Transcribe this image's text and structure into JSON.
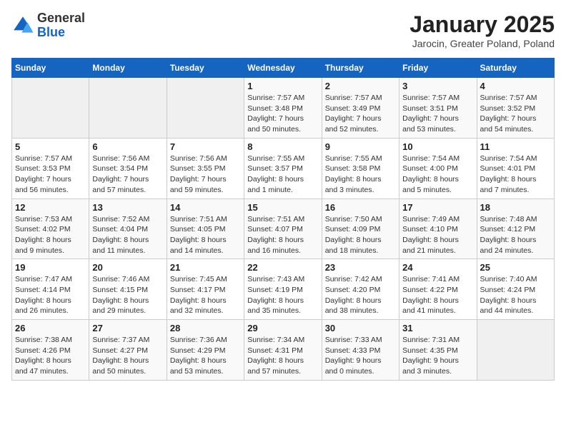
{
  "header": {
    "logo_general": "General",
    "logo_blue": "Blue",
    "month_title": "January 2025",
    "subtitle": "Jarocin, Greater Poland, Poland"
  },
  "days_of_week": [
    "Sunday",
    "Monday",
    "Tuesday",
    "Wednesday",
    "Thursday",
    "Friday",
    "Saturday"
  ],
  "weeks": [
    [
      {
        "day": "",
        "info": ""
      },
      {
        "day": "",
        "info": ""
      },
      {
        "day": "",
        "info": ""
      },
      {
        "day": "1",
        "info": "Sunrise: 7:57 AM\nSunset: 3:48 PM\nDaylight: 7 hours\nand 50 minutes."
      },
      {
        "day": "2",
        "info": "Sunrise: 7:57 AM\nSunset: 3:49 PM\nDaylight: 7 hours\nand 52 minutes."
      },
      {
        "day": "3",
        "info": "Sunrise: 7:57 AM\nSunset: 3:51 PM\nDaylight: 7 hours\nand 53 minutes."
      },
      {
        "day": "4",
        "info": "Sunrise: 7:57 AM\nSunset: 3:52 PM\nDaylight: 7 hours\nand 54 minutes."
      }
    ],
    [
      {
        "day": "5",
        "info": "Sunrise: 7:57 AM\nSunset: 3:53 PM\nDaylight: 7 hours\nand 56 minutes."
      },
      {
        "day": "6",
        "info": "Sunrise: 7:56 AM\nSunset: 3:54 PM\nDaylight: 7 hours\nand 57 minutes."
      },
      {
        "day": "7",
        "info": "Sunrise: 7:56 AM\nSunset: 3:55 PM\nDaylight: 7 hours\nand 59 minutes."
      },
      {
        "day": "8",
        "info": "Sunrise: 7:55 AM\nSunset: 3:57 PM\nDaylight: 8 hours\nand 1 minute."
      },
      {
        "day": "9",
        "info": "Sunrise: 7:55 AM\nSunset: 3:58 PM\nDaylight: 8 hours\nand 3 minutes."
      },
      {
        "day": "10",
        "info": "Sunrise: 7:54 AM\nSunset: 4:00 PM\nDaylight: 8 hours\nand 5 minutes."
      },
      {
        "day": "11",
        "info": "Sunrise: 7:54 AM\nSunset: 4:01 PM\nDaylight: 8 hours\nand 7 minutes."
      }
    ],
    [
      {
        "day": "12",
        "info": "Sunrise: 7:53 AM\nSunset: 4:02 PM\nDaylight: 8 hours\nand 9 minutes."
      },
      {
        "day": "13",
        "info": "Sunrise: 7:52 AM\nSunset: 4:04 PM\nDaylight: 8 hours\nand 11 minutes."
      },
      {
        "day": "14",
        "info": "Sunrise: 7:51 AM\nSunset: 4:05 PM\nDaylight: 8 hours\nand 14 minutes."
      },
      {
        "day": "15",
        "info": "Sunrise: 7:51 AM\nSunset: 4:07 PM\nDaylight: 8 hours\nand 16 minutes."
      },
      {
        "day": "16",
        "info": "Sunrise: 7:50 AM\nSunset: 4:09 PM\nDaylight: 8 hours\nand 18 minutes."
      },
      {
        "day": "17",
        "info": "Sunrise: 7:49 AM\nSunset: 4:10 PM\nDaylight: 8 hours\nand 21 minutes."
      },
      {
        "day": "18",
        "info": "Sunrise: 7:48 AM\nSunset: 4:12 PM\nDaylight: 8 hours\nand 24 minutes."
      }
    ],
    [
      {
        "day": "19",
        "info": "Sunrise: 7:47 AM\nSunset: 4:14 PM\nDaylight: 8 hours\nand 26 minutes."
      },
      {
        "day": "20",
        "info": "Sunrise: 7:46 AM\nSunset: 4:15 PM\nDaylight: 8 hours\nand 29 minutes."
      },
      {
        "day": "21",
        "info": "Sunrise: 7:45 AM\nSunset: 4:17 PM\nDaylight: 8 hours\nand 32 minutes."
      },
      {
        "day": "22",
        "info": "Sunrise: 7:43 AM\nSunset: 4:19 PM\nDaylight: 8 hours\nand 35 minutes."
      },
      {
        "day": "23",
        "info": "Sunrise: 7:42 AM\nSunset: 4:20 PM\nDaylight: 8 hours\nand 38 minutes."
      },
      {
        "day": "24",
        "info": "Sunrise: 7:41 AM\nSunset: 4:22 PM\nDaylight: 8 hours\nand 41 minutes."
      },
      {
        "day": "25",
        "info": "Sunrise: 7:40 AM\nSunset: 4:24 PM\nDaylight: 8 hours\nand 44 minutes."
      }
    ],
    [
      {
        "day": "26",
        "info": "Sunrise: 7:38 AM\nSunset: 4:26 PM\nDaylight: 8 hours\nand 47 minutes."
      },
      {
        "day": "27",
        "info": "Sunrise: 7:37 AM\nSunset: 4:27 PM\nDaylight: 8 hours\nand 50 minutes."
      },
      {
        "day": "28",
        "info": "Sunrise: 7:36 AM\nSunset: 4:29 PM\nDaylight: 8 hours\nand 53 minutes."
      },
      {
        "day": "29",
        "info": "Sunrise: 7:34 AM\nSunset: 4:31 PM\nDaylight: 8 hours\nand 57 minutes."
      },
      {
        "day": "30",
        "info": "Sunrise: 7:33 AM\nSunset: 4:33 PM\nDaylight: 9 hours\nand 0 minutes."
      },
      {
        "day": "31",
        "info": "Sunrise: 7:31 AM\nSunset: 4:35 PM\nDaylight: 9 hours\nand 3 minutes."
      },
      {
        "day": "",
        "info": ""
      }
    ]
  ]
}
